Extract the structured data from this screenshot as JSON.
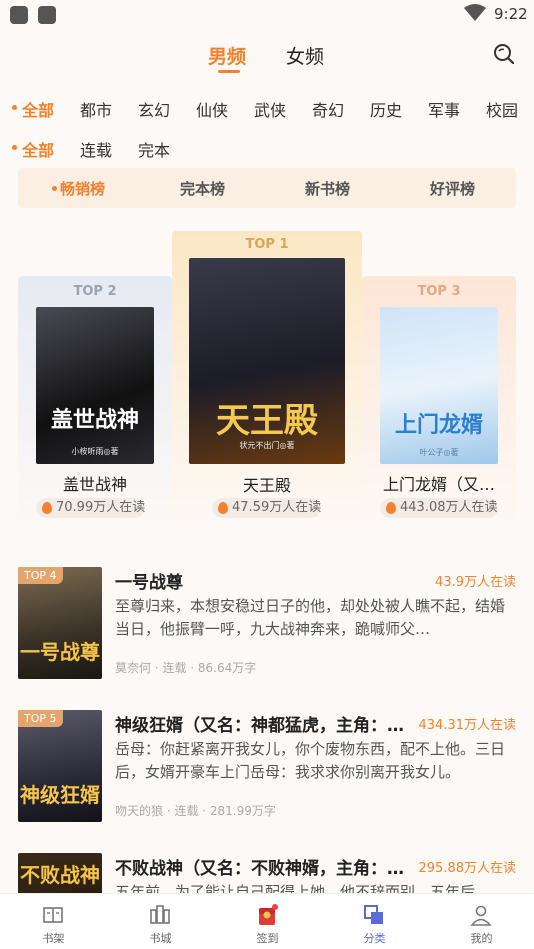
{
  "status_bar": {
    "time": "9:22"
  },
  "gender_tabs": [
    {
      "label": "男频",
      "active": true
    },
    {
      "label": "女频",
      "active": false
    }
  ],
  "categories": [
    "全部",
    "都市",
    "玄幻",
    "仙侠",
    "武侠",
    "奇幻",
    "历史",
    "军事",
    "校园"
  ],
  "status_filters": [
    "全部",
    "连载",
    "完本"
  ],
  "rank_tabs": [
    "畅销榜",
    "完本榜",
    "新书榜",
    "好评榜"
  ],
  "podium": [
    {
      "rank": "TOP 1",
      "title": "天王殿",
      "reads": "47.59万人在读",
      "cover_title": "天王殿",
      "cover_author": "状元不出门◎著"
    },
    {
      "rank": "TOP 2",
      "title": "盖世战神",
      "reads": "70.99万人在读",
      "cover_title": "盖世战神",
      "cover_author": "小桉听雨◎著"
    },
    {
      "rank": "TOP 3",
      "title": "上门龙婿（又…",
      "reads": "443.08万人在读",
      "cover_title": "上门龙婿",
      "cover_author": "叶公子◎著"
    }
  ],
  "list": [
    {
      "badge": "TOP 4",
      "cover_title": "一号战尊",
      "title": "一号战尊",
      "reads": "43.9万人在读",
      "desc": "至尊归来，本想安稳过日子的他，却处处被人瞧不起，结婚当日，他振臂一呼，九大战神奔来，跪喊师父…",
      "meta": "莫奈何 · 连载 · 86.64万字"
    },
    {
      "badge": "TOP 5",
      "cover_title": "神级狂婿",
      "title": "神级狂婿（又名：神都猛虎，主角：…",
      "reads": "434.31万人在读",
      "desc": "岳母：你赶紧离开我女儿，你个废物东西，配不上他。三日后，女婿开豪车上门岳母：我求求你别离开我女儿。",
      "meta": "吻天的狼 · 连载 · 281.99万字"
    },
    {
      "badge": "",
      "cover_title": "不败战神",
      "title": "不败战神（又名：不败神婿，主角：…",
      "reads": "295.88万人在读",
      "desc": "五年前，为了能让自己配得上她，他不辞而别，五年后",
      "meta": ""
    }
  ],
  "bottom_nav": [
    {
      "label": "书架",
      "icon": "bookshelf-icon"
    },
    {
      "label": "书城",
      "icon": "bookstore-icon"
    },
    {
      "label": "签到",
      "icon": "checkin-icon"
    },
    {
      "label": "分类",
      "icon": "category-icon",
      "active": true
    },
    {
      "label": "我的",
      "icon": "profile-icon"
    }
  ],
  "colors": {
    "accent": "#f2822f",
    "nav_active": "#5a6ad8",
    "podium_gold": "#fbe7c4",
    "podium_silver": "#e6eaf2",
    "podium_bronze": "#fde6d6"
  }
}
